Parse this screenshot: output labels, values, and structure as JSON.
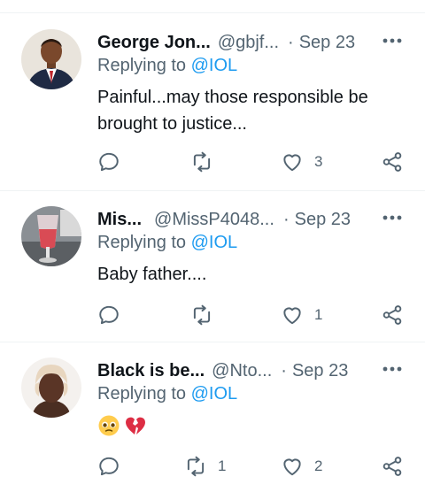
{
  "tweets": [
    {
      "name": "George Jon...",
      "handle": "@gbjf...",
      "separator": "·",
      "date": "Sep 23",
      "replying_prefix": "Replying to ",
      "replying_to": "@IOL",
      "text": "Painful...may those responsible be brought to justice...",
      "likes": "3",
      "retweets": "",
      "avatar_icon": "man-in-suit-avatar"
    },
    {
      "name": "Mis...",
      "handle": "@MissP4048...",
      "separator": "·",
      "date": "Sep 23",
      "replying_prefix": "Replying to ",
      "replying_to": "@IOL",
      "text": "Baby father....",
      "likes": "1",
      "retweets": "",
      "avatar_icon": "drink-glass-avatar"
    },
    {
      "name": "Black is be...",
      "handle": "@Nto...",
      "separator": "·",
      "date": "Sep 23",
      "replying_prefix": "Replying to ",
      "replying_to": "@IOL",
      "emojis": [
        "pleading-face-emoji",
        "broken-heart-emoji"
      ],
      "likes": "2",
      "retweets": "1",
      "avatar_icon": "woman-portrait-avatar"
    }
  ],
  "colors": {
    "accent": "#1d9bf0",
    "muted": "#536471",
    "text": "#0f1419",
    "divider": "#eff3f4"
  }
}
